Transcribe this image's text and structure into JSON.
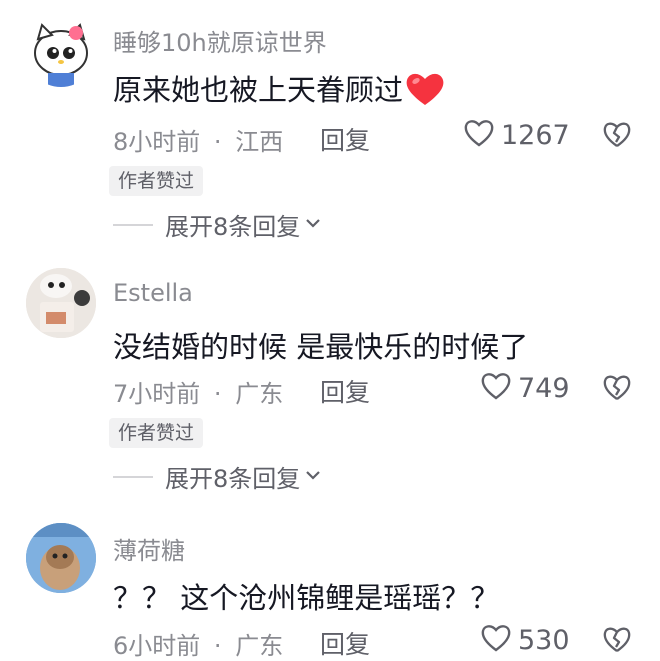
{
  "comments": [
    {
      "username": "睡够10h就原谅世界",
      "text": "原来她也被上天眷顾过",
      "emoji": "red-heart-emoji",
      "time": "8小时前",
      "separator": "·",
      "location": "江西",
      "reply_label": "回复",
      "likes": "1267",
      "badge": "作者赞过",
      "expand_label": "展开8条回复"
    },
    {
      "username": "Estella",
      "text": "没结婚的时候 是最快乐的时候了",
      "time": "7小时前",
      "separator": "·",
      "location": "广东",
      "reply_label": "回复",
      "likes": "749",
      "badge": "作者赞过",
      "expand_label": "展开8条回复"
    },
    {
      "username": "薄荷糖",
      "text": "？？ 这个沧州锦鲤是瑶瑶？？",
      "time": "6小时前",
      "separator": "·",
      "location": "广东",
      "reply_label": "回复",
      "likes": "530"
    }
  ],
  "colors": {
    "username": "#8a8b91",
    "text": "#161823",
    "secondary": "#5f6068",
    "badge_bg": "#f1f1f2",
    "heart_emoji": "#f5333f"
  }
}
